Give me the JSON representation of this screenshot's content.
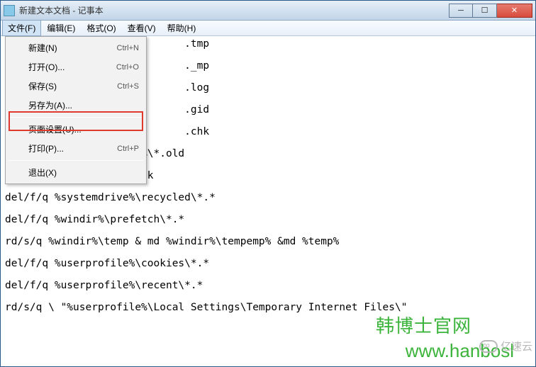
{
  "window": {
    "title": "新建文本文档 - 记事本"
  },
  "menubar": {
    "items": [
      {
        "label": "文件(F)"
      },
      {
        "label": "编辑(E)"
      },
      {
        "label": "格式(O)"
      },
      {
        "label": "查看(V)"
      },
      {
        "label": "帮助(H)"
      }
    ]
  },
  "dropdown": {
    "items": [
      {
        "label": "新建(N)",
        "shortcut": "Ctrl+N"
      },
      {
        "label": "打开(O)...",
        "shortcut": "Ctrl+O"
      },
      {
        "label": "保存(S)",
        "shortcut": "Ctrl+S"
      },
      {
        "label": "另存为(A)...",
        "shortcut": ""
      },
      {
        "_sep": true
      },
      {
        "label": "页面设置(U)...",
        "shortcut": ""
      },
      {
        "label": "打印(P)...",
        "shortcut": "Ctrl+P"
      },
      {
        "_sep": true
      },
      {
        "label": "退出(X)",
        "shortcut": ""
      }
    ]
  },
  "editor": {
    "text": "                             .tmp\n\n                             ._mp\n\n                             .log\n\n                             .gid\n\n                             .chk\n\ndel/f/s/q %systemdrive%\\*.old\n\ndel/f/s/q %windir%\\*.bak\n\ndel/f/q %systemdrive%\\recycled\\*.*\n\ndel/f/q %windir%\\prefetch\\*.*\n\nrd/s/q %windir%\\temp & md %windir%\\tempemp% &md %temp%\n\ndel/f/q %userprofile%\\cookies\\*.*\n\ndel/f/q %userprofile%\\recent\\*.*\n\nrd/s/q \\ \"%userprofile%\\Local Settings\\Temporary Internet Files\\\""
  },
  "watermark": {
    "line1": "韩博士官网",
    "line2": "www.hanbosl",
    "brand": "亿速云"
  }
}
